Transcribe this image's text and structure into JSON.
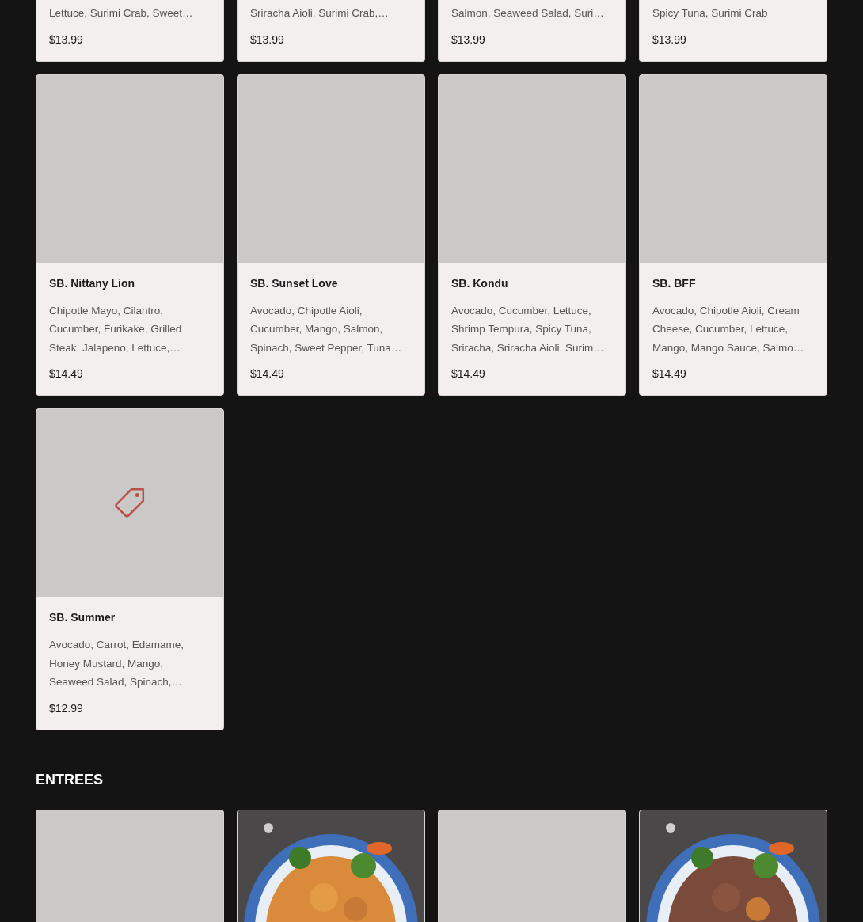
{
  "sections": [
    {
      "items": [
        {
          "description": "Lettuce, Surimi Crab, Sweet…",
          "price": "$13.99"
        },
        {
          "description": "Sriracha Aioli, Surimi Crab,…",
          "price": "$13.99"
        },
        {
          "description": "Salmon, Seaweed Salad, Suri…",
          "price": "$13.99"
        },
        {
          "description": "Spicy Tuna, Surimi Crab",
          "price": "$13.99"
        },
        {
          "kind": "placeholder",
          "name": "SB. Nittany Lion",
          "description": "Chipotle Mayo, Cilantro, Cucumber, Furikake, Grilled Steak, Jalapeno, Lettuce,…",
          "price": "$14.49"
        },
        {
          "kind": "placeholder",
          "name": "SB. Sunset Love",
          "description": "Avocado, Chipotle Aioli, Cucumber, Mango, Salmon, Spinach, Sweet Pepper, Tuna…",
          "price": "$14.49"
        },
        {
          "kind": "placeholder",
          "name": "SB. Kondu",
          "description": "Avocado, Cucumber, Lettuce, Shrimp Tempura, Spicy Tuna, Sriracha, Sriracha Aioli, Surim…",
          "price": "$14.49"
        },
        {
          "kind": "placeholder",
          "name": "SB. BFF",
          "description": "Avocado, Chipotle Aioli, Cream Cheese, Cucumber, Lettuce, Mango, Mango Sauce, Salmo…",
          "price": "$14.49"
        },
        {
          "kind": "icon",
          "name": "SB. Summer",
          "description": "Avocado, Carrot, Edamame, Honey Mustard, Mango, Seaweed Salad, Spinach,…",
          "price": "$12.99"
        }
      ]
    },
    {
      "heading": "ENTREES",
      "items": [
        {
          "kind": "placeholder"
        },
        {
          "kind": "picture"
        },
        {
          "kind": "placeholder"
        },
        {
          "kind": "picture"
        }
      ]
    }
  ]
}
